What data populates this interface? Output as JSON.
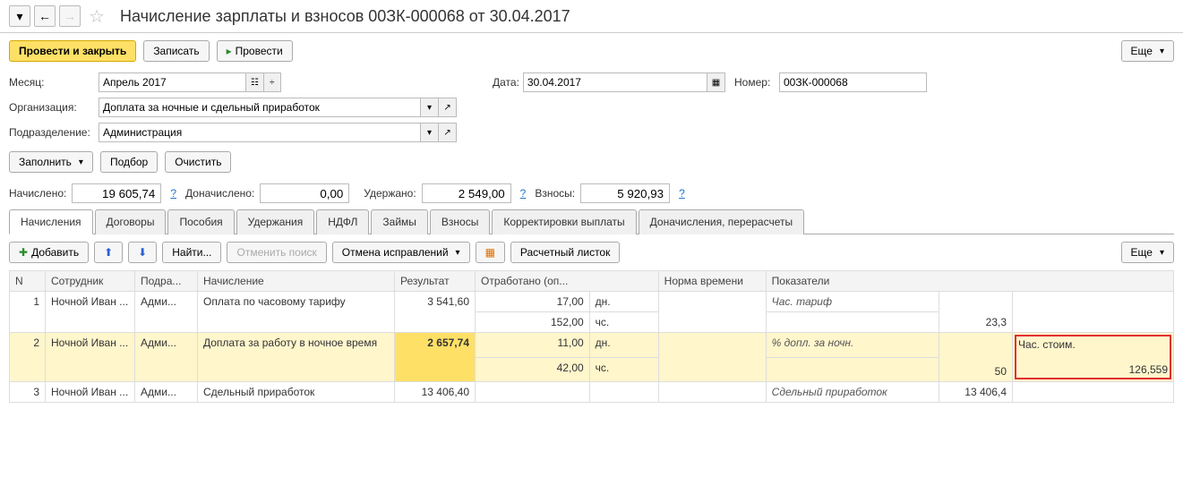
{
  "header": {
    "title": "Начисление зарплаты и взносов 00ЗК-000068 от 30.04.2017"
  },
  "toolbar": {
    "post_and_close": "Провести и закрыть",
    "record": "Записать",
    "post": "Провести",
    "more": "Еще"
  },
  "form": {
    "month_label": "Месяц:",
    "month_value": "Апрель 2017",
    "date_label": "Дата:",
    "date_value": "30.04.2017",
    "number_label": "Номер:",
    "number_value": "00ЗК-000068",
    "org_label": "Организация:",
    "org_value": "Доплата за ночные и сдельный приработок",
    "subdiv_label": "Подразделение:",
    "subdiv_value": "Администрация"
  },
  "actions": {
    "fill": "Заполнить",
    "select": "Подбор",
    "clear": "Очистить"
  },
  "totals": {
    "accrued_label": "Начислено:",
    "accrued_value": "19 605,74",
    "additional_label": "Доначислено:",
    "additional_value": "0,00",
    "withheld_label": "Удержано:",
    "withheld_value": "2 549,00",
    "contributions_label": "Взносы:",
    "contributions_value": "5 920,93",
    "q": "?"
  },
  "tabs": [
    "Начисления",
    "Договоры",
    "Пособия",
    "Удержания",
    "НДФЛ",
    "Займы",
    "Взносы",
    "Корректировки выплаты",
    "Доначисления, перерасчеты"
  ],
  "sub_toolbar": {
    "add": "Добавить",
    "find": "Найти...",
    "cancel_find": "Отменить поиск",
    "cancel_fix": "Отмена исправлений",
    "payslip": "Расчетный листок",
    "more": "Еще"
  },
  "columns": {
    "n": "N",
    "employee": "Сотрудник",
    "subdiv": "Подра...",
    "accrual": "Начисление",
    "result": "Результат",
    "worked": "Отработано (оп...",
    "norm": "Норма времени",
    "indicators": "Показатели"
  },
  "rows": [
    {
      "n": "1",
      "employee": "Ночной Иван ...",
      "subdiv": "Адми...",
      "accrual": "Оплата по часовому тарифу",
      "result": "3 541,60",
      "worked": [
        [
          "17,00",
          "дн."
        ],
        [
          "152,00",
          "чс."
        ]
      ],
      "indicator_label": "Час. тариф",
      "indicator_value": "23,3",
      "extra_label": "",
      "extra_value": ""
    },
    {
      "n": "2",
      "employee": "Ночной Иван ...",
      "subdiv": "Адми...",
      "accrual": "Доплата за работу в ночное время",
      "result": "2 657,74",
      "worked": [
        [
          "11,00",
          "дн."
        ],
        [
          "42,00",
          "чс."
        ]
      ],
      "indicator_label": "% допл. за ночн.",
      "indicator_value": "50",
      "extra_label": "Час. стоим.",
      "extra_value": "126,559",
      "highlight": true
    },
    {
      "n": "3",
      "employee": "Ночной Иван ...",
      "subdiv": "Адми...",
      "accrual": "Сдельный приработок",
      "result": "13 406,40",
      "worked": [],
      "indicator_label": "Сдельный приработок",
      "indicator_value": "13 406,4",
      "extra_label": "",
      "extra_value": ""
    }
  ]
}
